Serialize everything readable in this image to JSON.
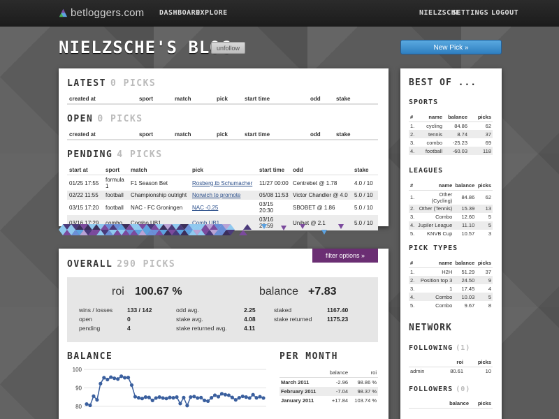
{
  "topbar": {
    "logo": "betloggers.com",
    "nav_left": [
      "DASHBOARD",
      "EXPLORE"
    ],
    "nav_right": [
      "NIELZSCHE",
      "SETTINGS",
      "LOGOUT"
    ]
  },
  "header": {
    "title": "NIELZSCHE'S BLOG",
    "unfollow": "unfollow",
    "new_pick": "New Pick »"
  },
  "picks": {
    "latest": {
      "title": "LATEST",
      "count": "0 PICKS"
    },
    "open": {
      "title": "OPEN",
      "count": "0 PICKS"
    },
    "pending": {
      "title": "PENDING",
      "count": "4 PICKS"
    },
    "columns_short": [
      "created at",
      "sport",
      "match",
      "pick",
      "start time",
      "odd",
      "stake"
    ],
    "pending_columns": [
      "start at",
      "sport",
      "match",
      "pick",
      "start time",
      "odd",
      "stake"
    ],
    "pending_rows": [
      [
        "01/25 17:55",
        "formula 1",
        "F1 Season Bet",
        "Rosberg.tb Schumacher",
        "11/27 00:00",
        "Centrebet @ 1.78",
        "4.0 / 10"
      ],
      [
        "02/22 11:55",
        "football",
        "Championship outright",
        "Norwich to promote",
        "05/08 11:53",
        "Victor Chandler @ 4.0",
        "5.0 / 10"
      ],
      [
        "03/15 17:20",
        "football",
        "NAC - FC Groningen",
        "NAC -0.25",
        "03/15 20:30",
        "SBOBET @ 1.86",
        "5.0 / 10"
      ],
      [
        "03/16 17:29",
        "combo",
        "Combo UB1",
        "Comb UB1",
        "03/16 20:59",
        "Unibet @ 2.1",
        "5.0 / 10"
      ]
    ]
  },
  "overall": {
    "title": "OVERALL",
    "count": "290 PICKS",
    "filter": "filter options »",
    "roi_label": "roi",
    "roi_value": "100.67 %",
    "balance_label": "balance",
    "balance_value": "+7.83",
    "stats_left": [
      {
        "label": "wins / losses",
        "value": "133 / 142"
      },
      {
        "label": "open",
        "value": "0"
      },
      {
        "label": "pending",
        "value": "4"
      }
    ],
    "stats_mid": [
      {
        "label": "odd avg.",
        "value": "2.25"
      },
      {
        "label": "stake avg.",
        "value": "4.08"
      },
      {
        "label": "stake returned avg.",
        "value": "4.11"
      }
    ],
    "stats_right": [
      {
        "label": "staked",
        "value": "1167.40"
      },
      {
        "label": "stake returned",
        "value": "1175.23"
      }
    ]
  },
  "balance_chart": {
    "title": "BALANCE",
    "accent": "#3a5f9e"
  },
  "chart_data": {
    "type": "line",
    "title": "BALANCE",
    "y_ticks": [
      100,
      90,
      80
    ],
    "ylim": [
      75,
      100
    ],
    "values": [
      81.2,
      80.5,
      85.5,
      83.5,
      92.3,
      95.5,
      94.5,
      95.8,
      95.2,
      94.8,
      96.3,
      95.5,
      95.6,
      91.5,
      85.2,
      84.6,
      84.2,
      85.0,
      84.8,
      83.2,
      84.5,
      85.0,
      84.5,
      84.2,
      84.8,
      84.6,
      85.0,
      81.5,
      84.7,
      80.4,
      85.0,
      85.3,
      84.5,
      84.7,
      83.2,
      82.8,
      84.6,
      86.0,
      85.2,
      86.8,
      86.3,
      86.0,
      84.8,
      83.5,
      84.6,
      85.4,
      85.0,
      84.5,
      86.3,
      84.6,
      85.2,
      84.5
    ]
  },
  "per_month": {
    "title": "PER MONTH",
    "columns": [
      "",
      "balance",
      "roi"
    ],
    "rows": [
      [
        "March 2011",
        "-2.96",
        "98.86 %"
      ],
      [
        "February 2011",
        "-7.04",
        "98.37 %"
      ],
      [
        "January 2011",
        "+17.84",
        "103.74 %"
      ]
    ]
  },
  "sidebar": {
    "title": "BEST OF ...",
    "sports": {
      "title": "SPORTS",
      "columns": [
        "#",
        "name",
        "balance",
        "picks"
      ],
      "rows": [
        [
          "1.",
          "cycling",
          "84.86",
          "62"
        ],
        [
          "2.",
          "tennis",
          "8.74",
          "37"
        ],
        [
          "3.",
          "combo",
          "-25.23",
          "69"
        ],
        [
          "4.",
          "football",
          "-60.03",
          "118"
        ]
      ]
    },
    "leagues": {
      "title": "LEAGUES",
      "columns": [
        "#",
        "name",
        "balance",
        "picks"
      ],
      "rows": [
        [
          "1.",
          "Other (Cycling)",
          "84.86",
          "62"
        ],
        [
          "2.",
          "Other (Tennis)",
          "15.39",
          "13"
        ],
        [
          "3.",
          "Combo",
          "12.60",
          "5"
        ],
        [
          "4.",
          "Jupiler League",
          "11.10",
          "5"
        ],
        [
          "5.",
          "KNVB Cup",
          "10.57",
          "3"
        ]
      ]
    },
    "pick_types": {
      "title": "PICK TYPES",
      "columns": [
        "#",
        "name",
        "balance",
        "picks"
      ],
      "rows": [
        [
          "1.",
          "H2H",
          "51.29",
          "37"
        ],
        [
          "2.",
          "Position top 3",
          "24.50",
          "9"
        ],
        [
          "3.",
          "1",
          "17.45",
          "4"
        ],
        [
          "4.",
          "Combo",
          "10.03",
          "5"
        ],
        [
          "5.",
          "Combo",
          "9.67",
          "8"
        ]
      ]
    },
    "network": {
      "title": "NETWORK",
      "following_title": "FOLLOWING",
      "following_count": "(1)",
      "following_columns": [
        "",
        "roi",
        "picks"
      ],
      "following_rows": [
        [
          "admin",
          "80.61",
          "10"
        ]
      ],
      "followers_title": "FOLLOWERS",
      "followers_count": "(0)",
      "followers_columns": [
        "",
        "balance",
        "picks"
      ]
    }
  }
}
